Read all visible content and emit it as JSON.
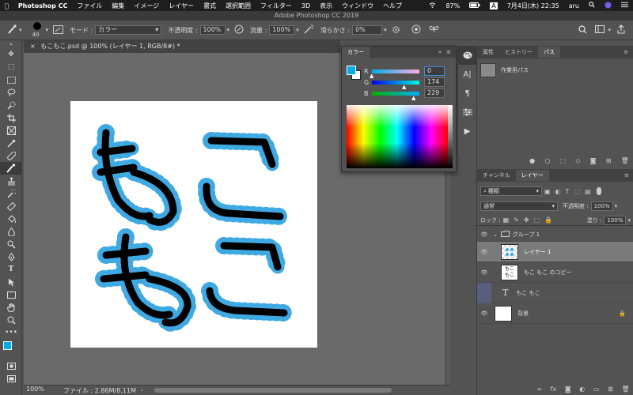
{
  "menubar": {
    "apple": "",
    "app": "Photoshop CC",
    "items": [
      "ファイル",
      "編集",
      "イメージ",
      "レイヤー",
      "書式",
      "選択範囲",
      "フィルター",
      "3D",
      "表示",
      "ウィンドウ",
      "ヘルプ"
    ],
    "battery": "87%",
    "input_method": "A",
    "datetime": "7月4日(木)  22:35",
    "user": "aru"
  },
  "window_title": "Adobe Photoshop CC 2019",
  "options": {
    "brush_size": "40",
    "mode_label": "モード :",
    "mode_value": "カラー",
    "opacity_label": "不透明度 :",
    "opacity_value": "100%",
    "flow_label": "流量 :",
    "flow_value": "100%",
    "smoothing_label": "滑らかさ :",
    "smoothing_value": "0%"
  },
  "document": {
    "tab_title": "もこもこ.psd @ 100% (レイヤー 1, RGB/8#) *",
    "zoom": "100%",
    "file_info": "ファイル : 2.86M/8.11M"
  },
  "color_panel": {
    "tab": "カラー",
    "r_label": "R",
    "g_label": "G",
    "b_label": "B",
    "r": "0",
    "g": "174",
    "b": "229",
    "fg_color": "#00aee5"
  },
  "properties_panel": {
    "tabs": [
      "属性",
      "ヒストリー",
      "パス"
    ],
    "path_name": "作業用パス"
  },
  "layers_panel": {
    "tabs": [
      "チャンネル",
      "レイヤー"
    ],
    "filter_value": "種類",
    "blend_mode": "通常",
    "opacity_label": "不透明度 :",
    "opacity_value": "100%",
    "lock_label": "ロック :",
    "fill_label": "塗り :",
    "fill_value": "100%",
    "layers": [
      {
        "name": "グループ 1"
      },
      {
        "name": "レイヤー 1"
      },
      {
        "name": "もこ もこ のコピー"
      },
      {
        "name": "もこ もこ"
      },
      {
        "name": "背景"
      }
    ]
  },
  "art": {
    "text_char": "も",
    "dot_color": "#3ea9e2",
    "stroke_color": "#000000"
  }
}
